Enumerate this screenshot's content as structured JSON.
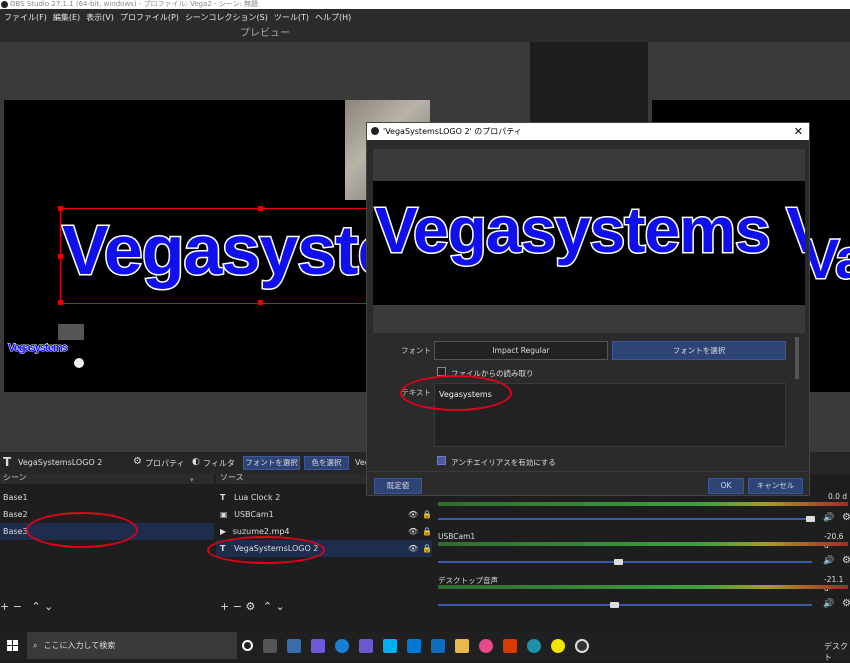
{
  "window": {
    "title": "OBS Studio 27.1.1 (64-bit, windows) - プロファイル: Vega2 - シーン: 無題"
  },
  "menu": [
    "ファイル(F)",
    "編集(E)",
    "表示(V)",
    "プロファイル(P)",
    "シーンコレクション(S)",
    "ツール(T)",
    "ヘルプ(H)"
  ],
  "preview": {
    "label": "プレビュー",
    "overlay_text": "Vegasystems",
    "small_text": "Vegasystems"
  },
  "dialog": {
    "title": "'VegaSystemsLOGO 2' のプロパティ",
    "close": "✕",
    "preview_text": "Vegasystems V",
    "font_label": "フォント",
    "font_value": "Impact Regular",
    "font_button": "フォントを選択",
    "file_read_label": "ファイルからの読み取り",
    "text_label": "テキスト",
    "text_value": "Vegasystems",
    "antialias_label": "アンチエイリアスを有効にする",
    "defaults_button": "既定値",
    "ok_button": "OK",
    "cancel_button": "キャンセル"
  },
  "source_toolbar": {
    "source_name": "VegaSystemsLOGO 2",
    "properties": "プロパティ",
    "filters": "フィルタ",
    "font_select": "フォントを選択",
    "color_select": "色を選択",
    "truncated": "Veg"
  },
  "scenes": {
    "header": "シーン",
    "items": [
      "Base1",
      "Base2",
      "Base3"
    ],
    "selected": 2
  },
  "sources": {
    "header": "ソース",
    "items": [
      {
        "name": "Lua Clock 2",
        "icon": "text-icon"
      },
      {
        "name": "USBCam1",
        "icon": "camera-icon"
      },
      {
        "name": "suzume2.mp4",
        "icon": "play-icon"
      },
      {
        "name": "VegaSystemsLOGO 2",
        "icon": "text-icon"
      }
    ],
    "selected": 3
  },
  "mixer": {
    "channels": [
      {
        "name": "",
        "db": "0.0 d",
        "level": 0.0
      },
      {
        "name": "USBCam1",
        "db": "-20.6 d",
        "level": 0.6
      },
      {
        "name": "デスクトップ音声",
        "db": "-21.1 d",
        "level": 0.58
      }
    ]
  },
  "taskbar": {
    "search_placeholder": "ここに入力して検索",
    "tray_text": "デスクト"
  },
  "colors": {
    "accent": "#2e4474",
    "highlight": "#e0001a",
    "text_blue": "#1010ee"
  }
}
